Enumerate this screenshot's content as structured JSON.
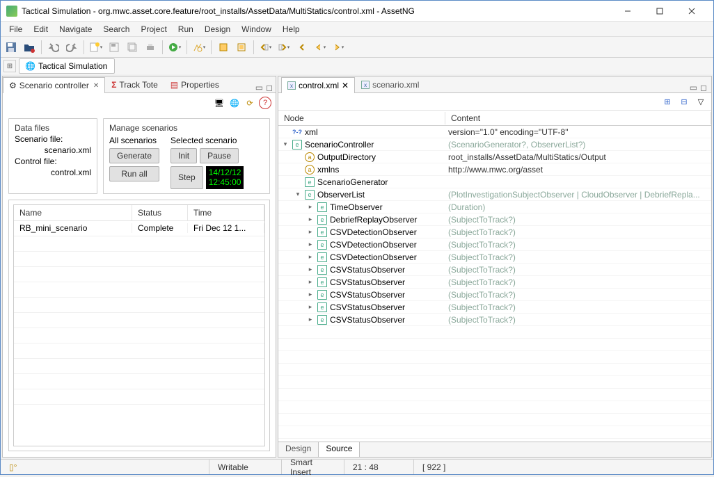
{
  "window": {
    "title": "Tactical Simulation - org.mwc.asset.core.feature/root_installs/AssetData/MultiStatics/control.xml - AssetNG"
  },
  "menu": [
    "File",
    "Edit",
    "Navigate",
    "Search",
    "Project",
    "Run",
    "Design",
    "Window",
    "Help"
  ],
  "perspective": {
    "active": "Tactical Simulation"
  },
  "leftTabs": {
    "t0": "Scenario controller",
    "t1": "Track Tote",
    "t2": "Properties"
  },
  "scenario": {
    "dataFilesLabel": "Data files",
    "scenarioFileLabel": "Scenario file:",
    "scenarioFile": "scenario.xml",
    "controlFileLabel": "Control file:",
    "controlFile": "control.xml",
    "manageLabel": "Manage scenarios",
    "allLabel": "All scenarios",
    "selectedLabel": "Selected scenario",
    "generateBtn": "Generate",
    "runAllBtn": "Run all",
    "initBtn": "Init",
    "pauseBtn": "Pause",
    "stepBtn": "Step",
    "timeLine1": "14/12/12",
    "timeLine2": "12:45:00",
    "cols": {
      "name": "Name",
      "status": "Status",
      "time": "Time"
    },
    "rows": [
      {
        "name": "RB_mini_scenario",
        "status": "Complete",
        "time": "Fri Dec 12 1..."
      }
    ]
  },
  "editorTabs": {
    "t0": "control.xml",
    "t1": "scenario.xml"
  },
  "tree": {
    "colNode": "Node",
    "colContent": "Content",
    "rows": [
      {
        "indent": 0,
        "twisty": "",
        "icon": "xml",
        "label": "xml",
        "content": "version=\"1.0\" encoding=\"UTF-8\"",
        "ghost": false,
        "iconText": "?-?"
      },
      {
        "indent": 0,
        "twisty": "v",
        "icon": "e",
        "label": "ScenarioController",
        "content": "(ScenarioGenerator?, ObserverList?)",
        "ghost": true,
        "iconText": "e"
      },
      {
        "indent": 1,
        "twisty": "",
        "icon": "a",
        "label": "OutputDirectory",
        "content": "root_installs/AssetData/MultiStatics/Output",
        "ghost": false,
        "iconText": "a"
      },
      {
        "indent": 1,
        "twisty": "",
        "icon": "a",
        "label": "xmlns",
        "content": "http://www.mwc.org/asset",
        "ghost": false,
        "iconText": "a"
      },
      {
        "indent": 1,
        "twisty": "",
        "icon": "e",
        "label": "ScenarioGenerator",
        "content": "",
        "ghost": false,
        "iconText": "e"
      },
      {
        "indent": 1,
        "twisty": "v",
        "icon": "e",
        "label": "ObserverList",
        "content": "(PlotInvestigationSubjectObserver | CloudObserver | DebriefRepla...",
        "ghost": true,
        "iconText": "e"
      },
      {
        "indent": 2,
        "twisty": ">",
        "icon": "e",
        "label": "TimeObserver",
        "content": "(Duration)",
        "ghost": true,
        "iconText": "e"
      },
      {
        "indent": 2,
        "twisty": ">",
        "icon": "e",
        "label": "DebriefReplayObserver",
        "content": "(SubjectToTrack?)",
        "ghost": true,
        "iconText": "e"
      },
      {
        "indent": 2,
        "twisty": ">",
        "icon": "e",
        "label": "CSVDetectionObserver",
        "content": "(SubjectToTrack?)",
        "ghost": true,
        "iconText": "e"
      },
      {
        "indent": 2,
        "twisty": ">",
        "icon": "e",
        "label": "CSVDetectionObserver",
        "content": "(SubjectToTrack?)",
        "ghost": true,
        "iconText": "e"
      },
      {
        "indent": 2,
        "twisty": ">",
        "icon": "e",
        "label": "CSVDetectionObserver",
        "content": "(SubjectToTrack?)",
        "ghost": true,
        "iconText": "e"
      },
      {
        "indent": 2,
        "twisty": ">",
        "icon": "e",
        "label": "CSVStatusObserver",
        "content": "(SubjectToTrack?)",
        "ghost": true,
        "iconText": "e"
      },
      {
        "indent": 2,
        "twisty": ">",
        "icon": "e",
        "label": "CSVStatusObserver",
        "content": "(SubjectToTrack?)",
        "ghost": true,
        "iconText": "e"
      },
      {
        "indent": 2,
        "twisty": ">",
        "icon": "e",
        "label": "CSVStatusObserver",
        "content": "(SubjectToTrack?)",
        "ghost": true,
        "iconText": "e"
      },
      {
        "indent": 2,
        "twisty": ">",
        "icon": "e",
        "label": "CSVStatusObserver",
        "content": "(SubjectToTrack?)",
        "ghost": true,
        "iconText": "e"
      },
      {
        "indent": 2,
        "twisty": ">",
        "icon": "e",
        "label": "CSVStatusObserver",
        "content": "(SubjectToTrack?)",
        "ghost": true,
        "iconText": "e"
      }
    ]
  },
  "editorBottom": {
    "design": "Design",
    "source": "Source"
  },
  "status": {
    "writable": "Writable",
    "insert": "Smart Insert",
    "pos": "21 : 48",
    "sel": "[ 922 ]"
  }
}
